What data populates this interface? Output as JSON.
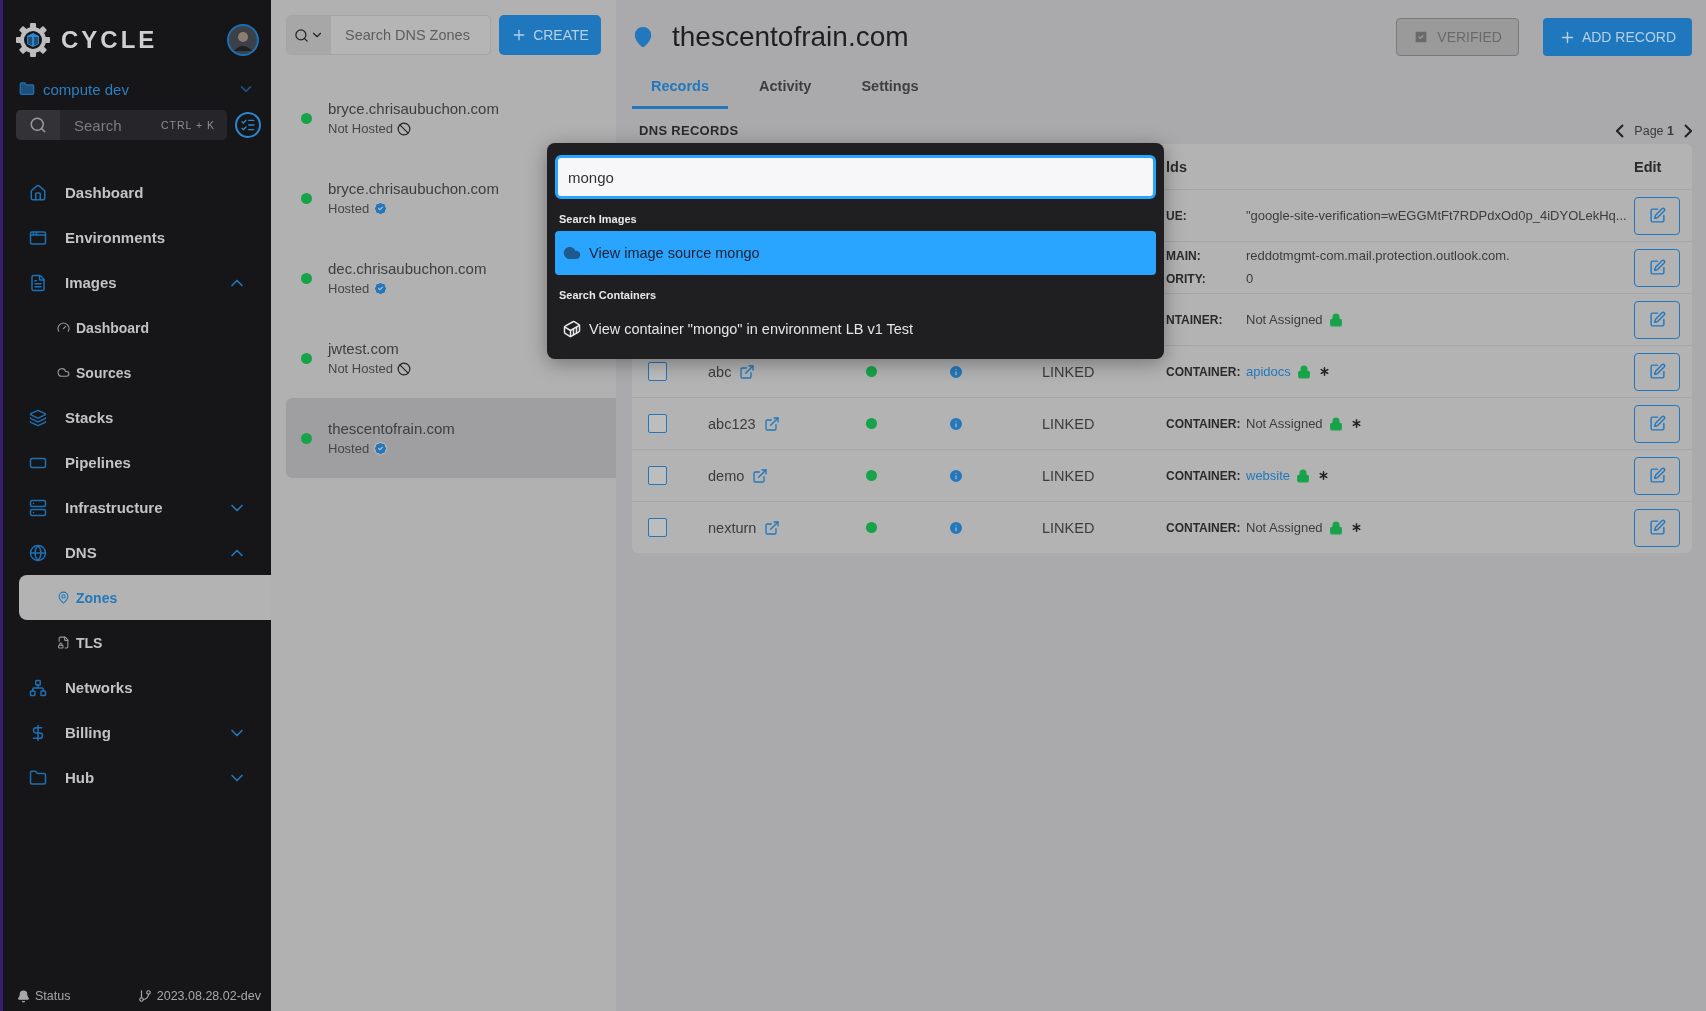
{
  "brand": {
    "name": "CYCLE"
  },
  "workspace": {
    "name": "compute dev"
  },
  "sidebar_search": {
    "placeholder": "Search",
    "shortcut": "CTRL + K"
  },
  "nav": [
    {
      "label": "Dashboard",
      "selected": false
    },
    {
      "label": "Environments",
      "selected": false
    },
    {
      "label": "Images",
      "selected": false,
      "expanded": true,
      "children": [
        {
          "label": "Dashboard",
          "selected": false
        },
        {
          "label": "Sources",
          "selected": false
        }
      ]
    },
    {
      "label": "Stacks",
      "selected": false
    },
    {
      "label": "Pipelines",
      "selected": false
    },
    {
      "label": "Infrastructure",
      "selected": false,
      "expanded": false
    },
    {
      "label": "DNS",
      "selected": false,
      "expanded": true,
      "children": [
        {
          "label": "Zones",
          "selected": true
        },
        {
          "label": "TLS",
          "selected": false
        }
      ]
    },
    {
      "label": "Networks",
      "selected": false
    },
    {
      "label": "Billing",
      "selected": false,
      "expanded": false
    },
    {
      "label": "Hub",
      "selected": false,
      "expanded": false
    }
  ],
  "footer": {
    "status": "Status",
    "version": "2023.08.28.02-dev"
  },
  "zones": {
    "search": {
      "placeholder": "Search DNS Zones"
    },
    "create": "CREATE",
    "items": [
      {
        "name": "bryce.chrisaubuchon.com",
        "status": "Not Hosted",
        "hosted": false,
        "selected": false
      },
      {
        "name": "bryce.chrisaubuchon.com",
        "status": "Hosted",
        "hosted": true,
        "selected": false
      },
      {
        "name": "dec.chrisaubuchon.com",
        "status": "Hosted",
        "hosted": true,
        "selected": false
      },
      {
        "name": "jwtest.com",
        "status": "Not Hosted",
        "hosted": false,
        "selected": false
      },
      {
        "name": "thescentofrain.com",
        "status": "Hosted",
        "hosted": true,
        "selected": true
      }
    ]
  },
  "zone": {
    "title": "thescentofrain.com",
    "verified": {
      "label": "VERIFIED",
      "checked": true
    },
    "add_record": "ADD RECORD",
    "tabs": [
      {
        "label": "Records",
        "selected": true
      },
      {
        "label": "Activity",
        "selected": false
      },
      {
        "label": "Settings",
        "selected": false
      }
    ]
  },
  "records": {
    "title": "DNS RECORDS",
    "page_label": "Page",
    "page": "1",
    "columns": {
      "fields": "lds",
      "edit": "Edit"
    },
    "rows": [
      {
        "fields": [
          {
            "label": "UE:",
            "value": "\"google-site-verification=wEGGMtFt7RDPdxOd0p_4iDYOLekHq..."
          }
        ]
      },
      {
        "fields": [
          {
            "label": "MAIN:",
            "value": "reddotmgmt-com.mail.protection.outlook.com."
          },
          {
            "label": "ORITY:",
            "value": "0"
          }
        ]
      },
      {
        "fields": [
          {
            "label": "NTAINER:",
            "value": "Not Assigned",
            "locked": true
          }
        ]
      },
      {
        "checked": false,
        "name": "abc",
        "type": "LINKED",
        "fields": [
          {
            "label": "CONTAINER:",
            "value": "apidocs",
            "link": true,
            "locked": true,
            "wildcard": true
          }
        ]
      },
      {
        "checked": false,
        "name": "abc123",
        "type": "LINKED",
        "fields": [
          {
            "label": "CONTAINER:",
            "value": "Not Assigned",
            "locked": true,
            "wildcard": true
          }
        ]
      },
      {
        "checked": false,
        "name": "demo",
        "type": "LINKED",
        "fields": [
          {
            "label": "CONTAINER:",
            "value": "website",
            "link": true,
            "locked": true,
            "wildcard": true
          }
        ]
      },
      {
        "checked": false,
        "name": "nexturn",
        "type": "LINKED",
        "fields": [
          {
            "label": "CONTAINER:",
            "value": "Not Assigned",
            "locked": true,
            "wildcard": true
          }
        ]
      }
    ]
  },
  "command_palette": {
    "value": "mongo",
    "sections": [
      {
        "title": "Search Images",
        "items": [
          {
            "label": "View image source mongo",
            "selected": true
          }
        ]
      },
      {
        "title": "Search Containers",
        "items": [
          {
            "label": "View container \"mongo\" in environment LB v1 Test",
            "selected": false
          }
        ]
      }
    ]
  }
}
